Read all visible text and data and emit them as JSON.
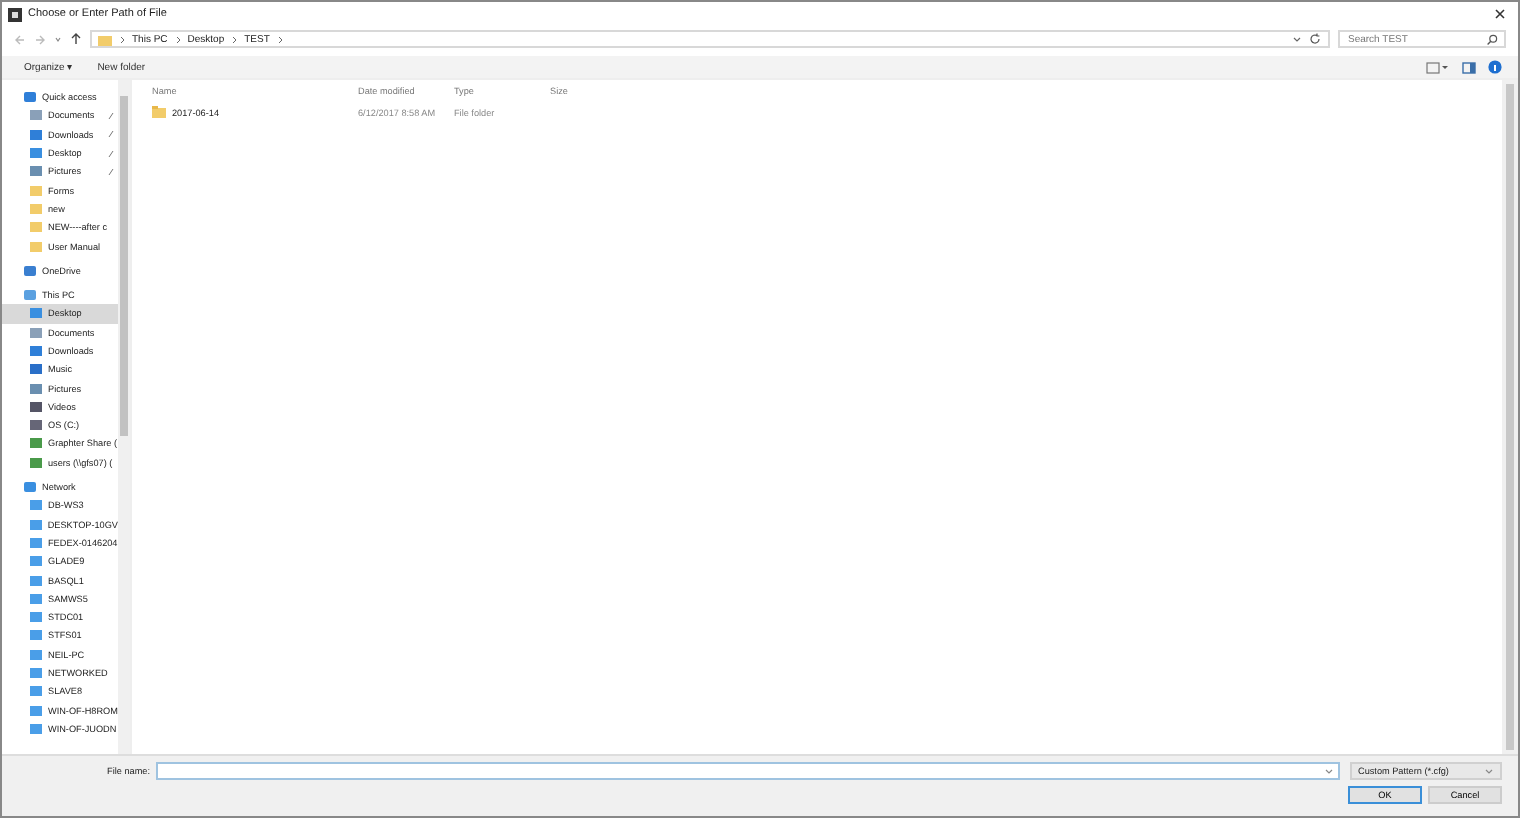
{
  "window": {
    "title": "Choose or Enter Path of File"
  },
  "address": {
    "crumbs": [
      "This PC",
      "Desktop",
      "TEST"
    ]
  },
  "search": {
    "placeholder": "Search TEST"
  },
  "toolbar": {
    "organize": "Organize ▾",
    "new_folder": "New folder"
  },
  "sidebar": {
    "groups": [
      {
        "label": "Quick access",
        "kind": "star",
        "children": [
          {
            "label": "Documents",
            "kind": "doc",
            "pinned": true,
            "selected": false
          },
          {
            "label": "Downloads",
            "kind": "down",
            "pinned": true,
            "selected": false
          },
          {
            "label": "Desktop",
            "kind": "desk",
            "pinned": true,
            "selected": false
          },
          {
            "label": "Pictures",
            "kind": "pic",
            "pinned": true,
            "selected": false
          },
          {
            "label": "Forms",
            "kind": "folder",
            "pinned": false,
            "selected": false
          },
          {
            "label": "new",
            "kind": "folder",
            "pinned": false,
            "selected": false
          },
          {
            "label": "NEW----after c",
            "kind": "folder",
            "pinned": false,
            "selected": false
          },
          {
            "label": "User Manual",
            "kind": "folder",
            "pinned": false,
            "selected": false
          }
        ]
      },
      {
        "label": "OneDrive",
        "kind": "cloud"
      },
      {
        "label": "This PC",
        "kind": "pc",
        "children": [
          {
            "label": "Desktop",
            "kind": "desk",
            "pinned": false,
            "selected": true
          },
          {
            "label": "Documents",
            "kind": "doc",
            "pinned": false,
            "selected": false
          },
          {
            "label": "Downloads",
            "kind": "down",
            "pinned": false,
            "selected": false
          },
          {
            "label": "Music",
            "kind": "music",
            "pinned": false,
            "selected": false
          },
          {
            "label": "Pictures",
            "kind": "pic",
            "pinned": false,
            "selected": false
          },
          {
            "label": "Videos",
            "kind": "video",
            "pinned": false,
            "selected": false
          },
          {
            "label": "OS (C:)",
            "kind": "drive",
            "pinned": false,
            "selected": false
          },
          {
            "label": "Graphter Share (",
            "kind": "netdrive",
            "pinned": false,
            "selected": false
          },
          {
            "label": "users (\\\\gfs07) (",
            "kind": "netdrive",
            "pinned": false,
            "selected": false
          }
        ]
      },
      {
        "label": "Network",
        "kind": "network",
        "children": [
          {
            "label": "DB-WS3",
            "kind": "monitor",
            "pinned": false,
            "selected": false
          },
          {
            "label": "DESKTOP-10GV",
            "kind": "monitor",
            "pinned": false,
            "selected": false
          },
          {
            "label": "FEDEX-0146204",
            "kind": "monitor",
            "pinned": false,
            "selected": false
          },
          {
            "label": "GLADE9",
            "kind": "monitor",
            "pinned": false,
            "selected": false
          },
          {
            "label": "BASQL1",
            "kind": "monitor",
            "pinned": false,
            "selected": false
          },
          {
            "label": "SAMWS5",
            "kind": "monitor",
            "pinned": false,
            "selected": false
          },
          {
            "label": "STDC01",
            "kind": "monitor",
            "pinned": false,
            "selected": false
          },
          {
            "label": "STFS01",
            "kind": "monitor",
            "pinned": false,
            "selected": false
          },
          {
            "label": "NEIL-PC",
            "kind": "monitor",
            "pinned": false,
            "selected": false
          },
          {
            "label": "NETWORKED",
            "kind": "monitor",
            "pinned": false,
            "selected": false
          },
          {
            "label": "SLAVE8",
            "kind": "monitor",
            "pinned": false,
            "selected": false
          },
          {
            "label": "WIN-OF-H8ROM",
            "kind": "monitor",
            "pinned": false,
            "selected": false
          },
          {
            "label": "WIN-OF-JUODN",
            "kind": "monitor",
            "pinned": false,
            "selected": false
          }
        ]
      }
    ]
  },
  "table": {
    "columns": [
      "Name",
      "Date modified",
      "Type",
      "Size"
    ],
    "rows": [
      {
        "name": "2017-06-14",
        "date": "6/12/2017 8:58 AM",
        "type": "File folder",
        "selected": false
      }
    ]
  },
  "footer": {
    "file_name_label": "File name:",
    "filter": "Custom Pattern (*.cfg)",
    "buttons": [
      "OK",
      "Cancel"
    ]
  }
}
